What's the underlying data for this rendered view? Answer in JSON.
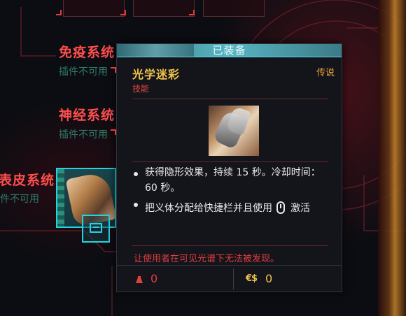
{
  "categories": [
    {
      "name": "免疫系统",
      "status": "插件不可用"
    },
    {
      "name": "神经系统",
      "status": "插件不可用"
    },
    {
      "name": "表皮系统",
      "status": "件不可用"
    }
  ],
  "tooltip": {
    "equipped_label": "已装备",
    "item_name": "光学迷彩",
    "item_type": "技能",
    "rarity": "传说",
    "effects": [
      "获得隐形效果，持续 15 秒。冷却时间：60 秒。"
    ],
    "activation_text_before": "把义体分配给快捷栏并且使用",
    "activation_text_after": "激活",
    "activation_icon": "mouse-icon",
    "flavor_text": "让使用者在可见光谱下无法被发现。",
    "weight": "0",
    "price": "0",
    "price_icon_text": "€$",
    "weight_icon": "weight-icon"
  },
  "colors": {
    "accent_red": "#ff4e4e",
    "accent_cyan": "#26d3e0",
    "gold": "#f0c44a",
    "status_green": "#2f7a6a"
  }
}
